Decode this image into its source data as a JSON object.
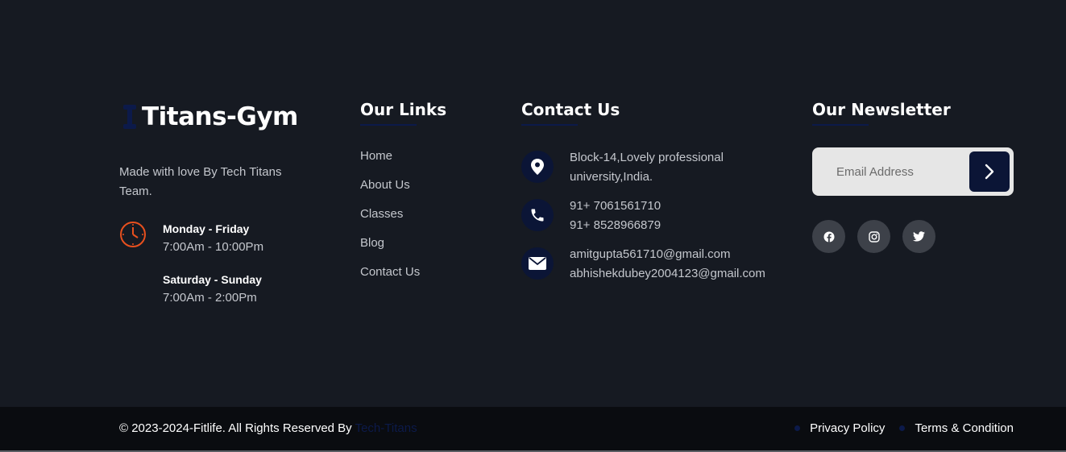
{
  "brand": {
    "name": "Titans-Gym",
    "tagline": "Made with love By Tech Titans Team.",
    "hours": [
      {
        "days": "Monday - Friday",
        "time": "7:00Am - 10:00Pm"
      },
      {
        "days": "Saturday - Sunday",
        "time": "7:00Am - 2:00Pm"
      }
    ]
  },
  "links": {
    "heading": "Our Links",
    "items": [
      "Home",
      "About Us",
      "Classes",
      "Blog",
      "Contact Us"
    ]
  },
  "contact": {
    "heading": "Contact Us",
    "address": [
      "Block-14,Lovely professional",
      "university,India."
    ],
    "phones": [
      "91+ 7061561710",
      "91+ 8528966879"
    ],
    "emails": [
      "amitgupta561710@gmail.com",
      "abhishekdubey2004123@gmail.com"
    ]
  },
  "newsletter": {
    "heading": "Our Newsletter",
    "placeholder": "Email Address",
    "socials": [
      "facebook-icon",
      "instagram-icon",
      "twitter-icon"
    ]
  },
  "bottom": {
    "copyright": "© 2023-2024-Fitlife. All Rights Reserved By",
    "author": "Tech-Titans",
    "legal": [
      "Privacy Policy",
      "Terms & Condition"
    ]
  },
  "colors": {
    "background": "#161a22",
    "bottom_bar": "#0a0c10",
    "accent_navy": "#0b1536",
    "clock_orange": "#e8501e"
  }
}
